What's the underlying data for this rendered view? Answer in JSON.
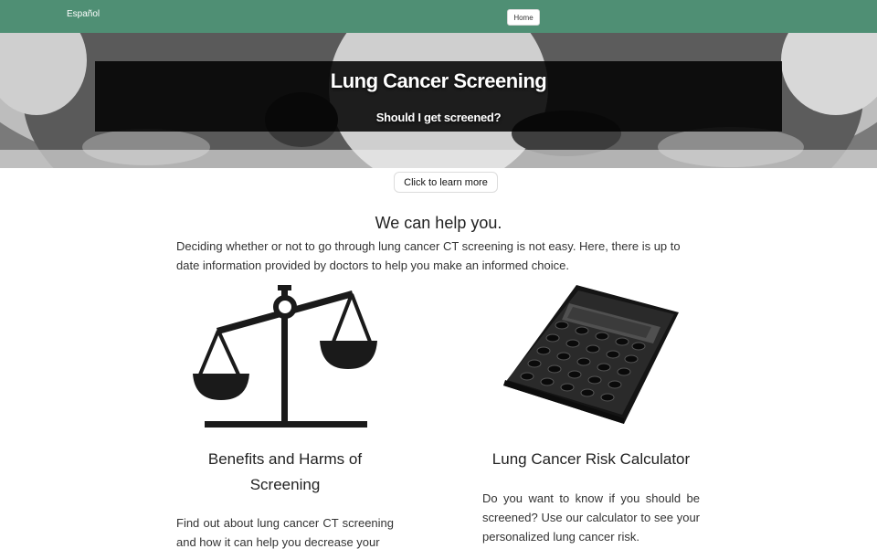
{
  "navbar": {
    "language_link": "Español",
    "home_button": "Home"
  },
  "hero": {
    "title": "Lung Cancer Screening",
    "subtitle": "Should I get screened?"
  },
  "learn_more_button": "Click to learn more",
  "intro": {
    "heading": "We can help you.",
    "text": "Deciding whether or not to go through lung cancer CT screening is not easy. Here, there is up to date information provided by doctors to help you make an informed choice."
  },
  "cards": [
    {
      "icon": "scale-icon",
      "title": "Benefits and Harms of Screening",
      "text": "Find out about lung cancer CT screening and how it can help you decrease your"
    },
    {
      "icon": "calculator-icon",
      "title": "Lung Cancer Risk Calculator",
      "text": "Do you want to know if you should be screened? Use our calculator to see your personalized lung cancer risk."
    }
  ],
  "colors": {
    "navbar": "#4f8f74",
    "hero_overlay": "#000000",
    "page_bg": "#ffffff"
  }
}
